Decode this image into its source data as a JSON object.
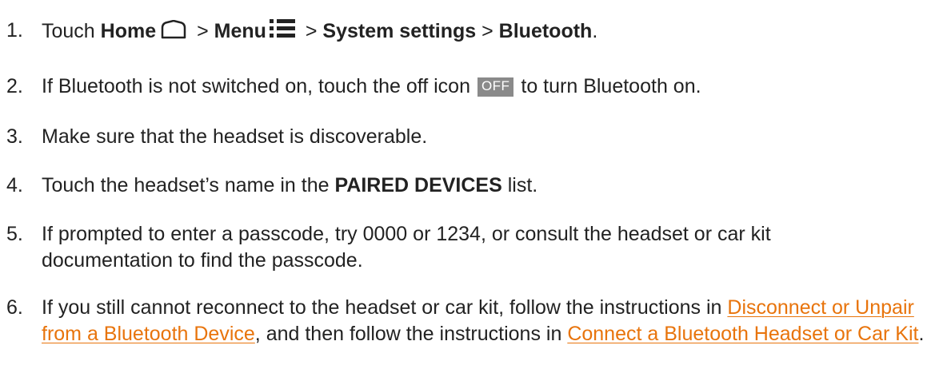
{
  "colors": {
    "text": "#222222",
    "link": "#e8740c",
    "off_icon_bg": "#8a8a8a"
  },
  "steps": [
    {
      "num": "1.",
      "parts": {
        "a": "Touch ",
        "home": "Home",
        "b": " > ",
        "menu": "Menu",
        "c": " > ",
        "system_settings": "System settings",
        "d": " > ",
        "bluetooth": "Bluetooth",
        "e": "."
      },
      "icons": [
        "home-icon",
        "menu-icon"
      ]
    },
    {
      "num": "2.",
      "parts": {
        "a": "If Bluetooth is not switched on, touch the off icon ",
        "off_label": "OFF",
        "b": " to turn Bluetooth on."
      }
    },
    {
      "num": "3.",
      "text": "Make sure that the headset is discoverable."
    },
    {
      "num": "4.",
      "parts": {
        "a": "Touch the headset’s name in the ",
        "paired": "PAIRED DEVICES",
        "b": " list."
      }
    },
    {
      "num": "5.",
      "line1": "If prompted to enter a passcode, try 0000 or 1234, or consult the headset or car kit",
      "line2": "documentation to find the passcode."
    },
    {
      "num": "6.",
      "parts": {
        "a": "If you still cannot reconnect to the headset or car kit, follow the instructions in ",
        "link1": "Disconnect or Unpair from a Bluetooth Device",
        "b": ", and then follow the instructions in ",
        "link2": "Connect a Bluetooth Headset or Car Kit",
        "c": "."
      }
    }
  ]
}
